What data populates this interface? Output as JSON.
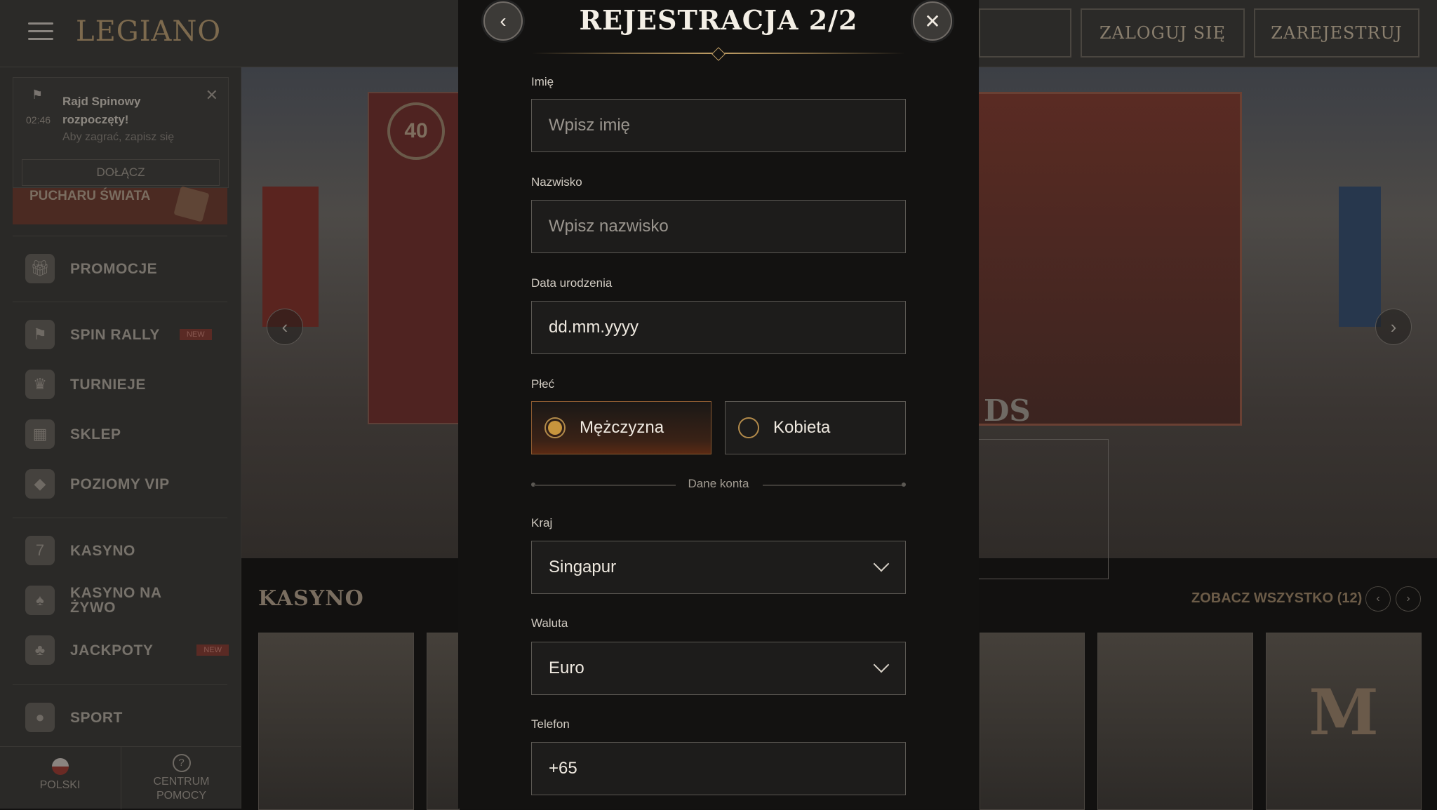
{
  "header": {
    "logo": "LEGIANO",
    "ghost_button": "",
    "login_label": "ZALOGUJ SIĘ",
    "register_label": "ZAREJESTRUJ"
  },
  "notification": {
    "title_line1": "Rajd Spinowy",
    "title_line2": "rozpoczęty!",
    "time": "02:46",
    "subtitle": "Aby zagrać, zapisz się",
    "join_label": "DOŁĄCZ"
  },
  "sidebar": {
    "promo_banner": "PUCHARU ŚWIATA",
    "items": [
      {
        "label": "PROMOCJE",
        "icon": "gift-icon",
        "badge": ""
      },
      {
        "label": "SPIN RALLY",
        "icon": "checkered-flag-icon",
        "badge": "NEW"
      },
      {
        "label": "TURNIEJE",
        "icon": "trophy-icon",
        "badge": ""
      },
      {
        "label": "SKLEP",
        "icon": "shop-icon",
        "badge": ""
      },
      {
        "label": "POZIOMY VIP",
        "icon": "diamond-icon",
        "badge": ""
      },
      {
        "label": "KASYNO",
        "icon": "slot-machine-icon",
        "badge": ""
      },
      {
        "label": "KASYNO NA ŻYWO",
        "icon": "cards-icon",
        "badge": ""
      },
      {
        "label": "JACKPOTY",
        "icon": "clover-icon",
        "badge": "NEW"
      },
      {
        "label": "SPORT",
        "icon": "ball-icon",
        "badge": ""
      }
    ],
    "language_label": "POLSKI",
    "help_label": "CENTRUM POMOCY"
  },
  "banner": {
    "card_badge": "40",
    "partial_text": "DS"
  },
  "casino_section": {
    "title": "KASYNO",
    "see_all": "ZOBACZ WSZYSTKO (12)",
    "game_letter": "M"
  },
  "modal": {
    "title": "REJESTRACJA 2/2",
    "fields": {
      "first_name": {
        "label": "Imię",
        "placeholder": "Wpisz imię"
      },
      "last_name": {
        "label": "Nazwisko",
        "placeholder": "Wpisz nazwisko"
      },
      "birth_date": {
        "label": "Data urodzenia",
        "value": "dd.mm.yyyy"
      },
      "gender": {
        "label": "Płeć",
        "options": [
          "Mężczyzna",
          "Kobieta"
        ],
        "selected": "Mężczyzna"
      },
      "section_divider": "Dane konta",
      "country": {
        "label": "Kraj",
        "value": "Singapur"
      },
      "currency": {
        "label": "Waluta",
        "value": "Euro"
      },
      "phone": {
        "label": "Telefon",
        "value": "+65"
      }
    }
  },
  "colors": {
    "accent_gold": "#c7953d",
    "modal_bg": "#131211",
    "field_bg": "#1d1c1b"
  }
}
